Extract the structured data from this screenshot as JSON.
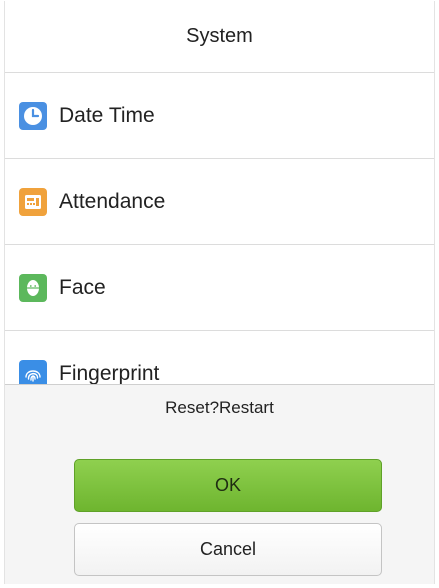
{
  "header": {
    "title": "System"
  },
  "menu": {
    "items": [
      {
        "label": "Date Time",
        "icon": "clock-icon",
        "color": "#4a90e2"
      },
      {
        "label": "Attendance",
        "icon": "attendance-icon",
        "color": "#f0a23c"
      },
      {
        "label": "Face",
        "icon": "face-icon",
        "color": "#5cb85c"
      },
      {
        "label": "Fingerprint",
        "icon": "fingerprint-icon",
        "color": "#3a8ee6"
      }
    ]
  },
  "dialog": {
    "message": "Reset?Restart",
    "ok_label": "OK",
    "cancel_label": "Cancel"
  },
  "colors": {
    "ok_button": "#7cc23c",
    "dialog_background": "#f5f5f5"
  }
}
